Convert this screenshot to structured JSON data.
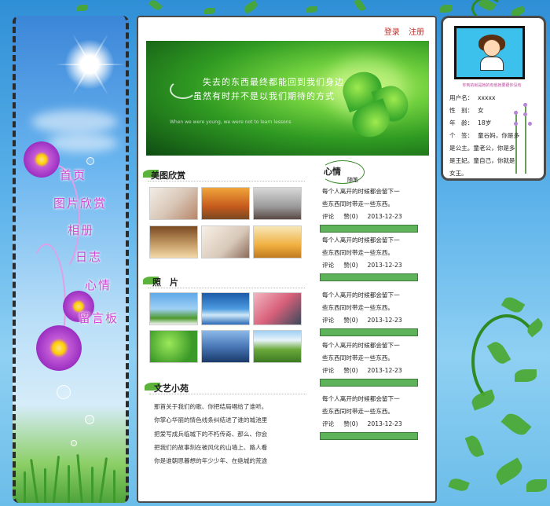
{
  "nav": {
    "items": [
      {
        "label": "首页"
      },
      {
        "label": "图片欣赏"
      },
      {
        "label": "相册"
      },
      {
        "label": "日志"
      },
      {
        "label": "心情"
      },
      {
        "label": "留言板"
      }
    ]
  },
  "header": {
    "login": "登录",
    "register": "注册"
  },
  "banner": {
    "line1": "失去的东西最终都能回到我们身边",
    "line2": "虽然有时并不是以我们期待的方式",
    "small_text": "When we were young, we were not to learn lessons"
  },
  "sections": {
    "gallery_title": "美图欣赏",
    "photos_title": "照　片",
    "literature_title": "文艺小苑",
    "mood_title": "心情",
    "mood_subtitle": "随笔"
  },
  "essay": {
    "lines": [
      "那首关于我们的歌、你把结局唱给了谁听。",
      "你掌心华丽的情色线条纠结进了谁的城池里",
      "把爱写成兵临城下的不朽传奇、那么、你会",
      "把我们的故事刻在被风化的山墙上、路人看",
      "你是谁朝思暮想的年少少年、在绝城的荒途"
    ]
  },
  "mood_entries": [
    {
      "line1": "每个人离开的时候都会留下一",
      "line2": "些东西同时带走一些东西。",
      "comment": "评论",
      "like": "赞(0)",
      "date": "2013-12-23"
    },
    {
      "line1": "每个人离开的时候都会留下一",
      "line2": "些东西同时带走一些东西。",
      "comment": "评论",
      "like": "赞(0)",
      "date": "2013-12-23"
    },
    {
      "line1": "每个人离开的时候都会留下一",
      "line2": "些东西同时带走一些东西。",
      "comment": "评论",
      "like": "赞(0)",
      "date": "2013-12-23"
    },
    {
      "line1": "每个人离开的时候都会留下一",
      "line2": "些东西同时带走一些东西。",
      "comment": "评论",
      "like": "赞(0)",
      "date": "2013-12-23"
    }
  ],
  "profile": {
    "avatar_caption": "你到的就是她的有他她要跟你没有",
    "rows": [
      {
        "key": "用户名：",
        "value": "xxxxx"
      },
      {
        "key": "性　别：",
        "value": "女"
      },
      {
        "key": "年　龄：",
        "value": "18岁"
      }
    ],
    "sig_key": "个　签：",
    "sig_lines": [
      "童谷妈，你是多",
      "是公主。童老公，你是多",
      "是王妃。童自己，你就是",
      "女王。"
    ]
  },
  "colors": {
    "nav_text": "#d447d4",
    "link_red": "#c0302a",
    "entry_bar": "#5eb35a",
    "sky": "#5db3ea"
  }
}
